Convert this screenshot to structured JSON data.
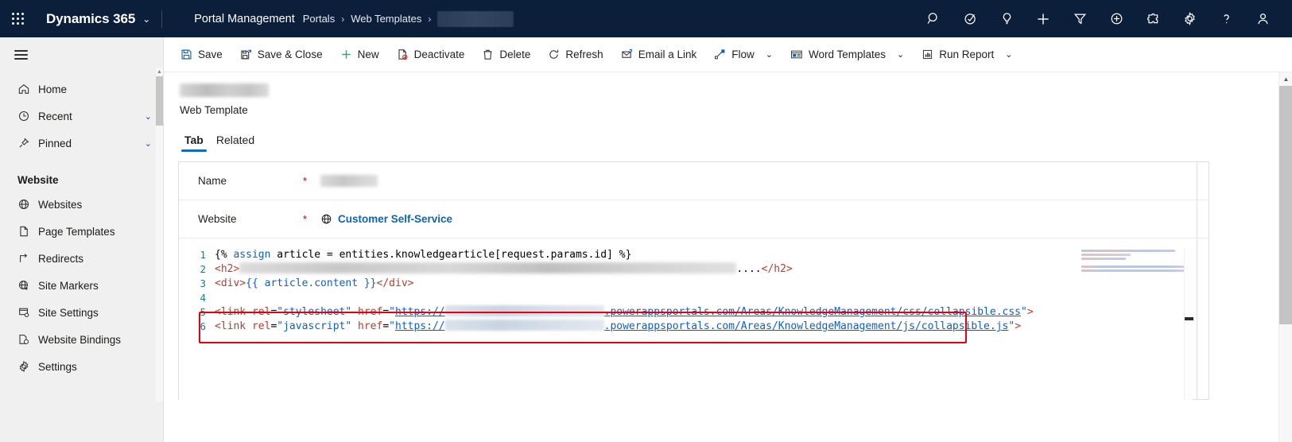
{
  "topnav": {
    "waffle_label": "app-launcher",
    "brand": "Dynamics 365",
    "brand_caret": "⌄",
    "app_name": "Portal Management",
    "breadcrumb": [
      {
        "label": "Portals",
        "redacted": false
      },
      {
        "label": "Web Templates",
        "redacted": false
      },
      {
        "label": "",
        "redacted": true
      }
    ],
    "separator": "›",
    "icons": [
      "search-icon",
      "diagnostics-icon",
      "lightbulb-icon",
      "add-icon",
      "filter-icon",
      "quick-create-icon",
      "connector-icon",
      "settings-gear-icon",
      "help-icon",
      "user-account-icon"
    ]
  },
  "sidebar": {
    "hamburger_label": "site-map-toggle",
    "items": [
      {
        "label": "Home",
        "icon": "home-icon",
        "caret": false
      },
      {
        "label": "Recent",
        "icon": "clock-icon",
        "caret": true
      },
      {
        "label": "Pinned",
        "icon": "pin-icon",
        "caret": true
      }
    ],
    "group_label": "Website",
    "group_items": [
      {
        "label": "Websites",
        "icon": "globe-icon"
      },
      {
        "label": "Page Templates",
        "icon": "page-icon"
      },
      {
        "label": "Redirects",
        "icon": "redirect-arrow-icon"
      },
      {
        "label": "Site Markers",
        "icon": "globe-star-icon"
      },
      {
        "label": "Site Settings",
        "icon": "site-settings-icon"
      },
      {
        "label": "Website Bindings",
        "icon": "binding-icon"
      },
      {
        "label": "Settings",
        "icon": "gear-icon"
      }
    ],
    "caret_glyph": "⌄"
  },
  "commandbar": {
    "items": [
      {
        "label": "Save",
        "icon": "save-icon",
        "dropdown": false
      },
      {
        "label": "Save & Close",
        "icon": "save-close-icon",
        "dropdown": false
      },
      {
        "label": "New",
        "icon": "plus-icon",
        "dropdown": false
      },
      {
        "label": "Deactivate",
        "icon": "deactivate-icon",
        "dropdown": false
      },
      {
        "label": "Delete",
        "icon": "trash-icon",
        "dropdown": false
      },
      {
        "label": "Refresh",
        "icon": "refresh-icon",
        "dropdown": false
      },
      {
        "label": "Email a Link",
        "icon": "email-link-icon",
        "dropdown": false
      },
      {
        "label": "Flow",
        "icon": "flow-icon",
        "dropdown": true
      },
      {
        "label": "Word Templates",
        "icon": "word-template-icon",
        "dropdown": true
      },
      {
        "label": "Run Report",
        "icon": "report-icon",
        "dropdown": true
      }
    ],
    "dropdown_glyph": "⌄"
  },
  "record": {
    "title_redacted": true,
    "entity_label": "Web Template",
    "tabs": [
      {
        "label": "Tab",
        "active": true
      },
      {
        "label": "Related",
        "active": false
      }
    ]
  },
  "form": {
    "fields": [
      {
        "label": "Name",
        "required": "*",
        "value": "",
        "redacted": true,
        "is_link": false,
        "icon": ""
      },
      {
        "label": "Website",
        "required": "*",
        "value": "Customer Self-Service",
        "redacted": false,
        "is_link": true,
        "icon": "globe-icon"
      }
    ]
  },
  "editor": {
    "lines": [
      {
        "num": "1"
      },
      {
        "num": "2"
      },
      {
        "num": "3"
      },
      {
        "num": "4"
      },
      {
        "num": "5"
      },
      {
        "num": "6"
      }
    ],
    "line1": {
      "open": "{%",
      "kw": " assign ",
      "var": "article",
      "eq": " = ",
      "expr": "entities.knowledgearticle[request.params.id]",
      "close": " %}"
    },
    "line2": {
      "tag_open": "<h2>",
      "redacted_text": true,
      "ellipsis": "....",
      "tag_close": "</h2>"
    },
    "line3": {
      "tag_open": "<div>",
      "output": "{{ article.content }}",
      "tag_close": "</div>"
    },
    "line4": {
      "empty": ""
    },
    "line5": {
      "tag": "<link",
      "attr1": " rel",
      "eq1": "=",
      "val1": "\"stylesheet\"",
      "attr2": " href",
      "eq2": "=",
      "quote_open": "\"",
      "url_scheme": "https://",
      "url_redacted": true,
      "url_rest": ".powerappsportals.com/Areas/KnowledgeManagement/css/collapsible.css",
      "quote_close": "\"",
      "tag_end": ">"
    },
    "line6": {
      "tag": "<link",
      "attr1": " rel",
      "eq1": "=",
      "val1": "\"javascript\"",
      "attr2": " href",
      "eq2": "=",
      "quote_open": "\"",
      "url_scheme": "https://",
      "url_redacted": true,
      "url_rest": ".powerappsportals.com/Areas/KnowledgeManagement/js/collapsible.js",
      "quote_close": "\"",
      "tag_end": ">"
    },
    "highlight": {
      "name": "red-annotation-box",
      "color": "#e8000d"
    },
    "minimap_label": "code-minimap"
  },
  "colors": {
    "nav_bg": "#0b1f3a",
    "accent": "#0f6cbd",
    "link": "#0b64c0",
    "required": "#c00000",
    "highlight_red": "#e8000d",
    "sidebar_bg": "#f0f0f0"
  },
  "scroll": {
    "up_glyph": "▲"
  }
}
